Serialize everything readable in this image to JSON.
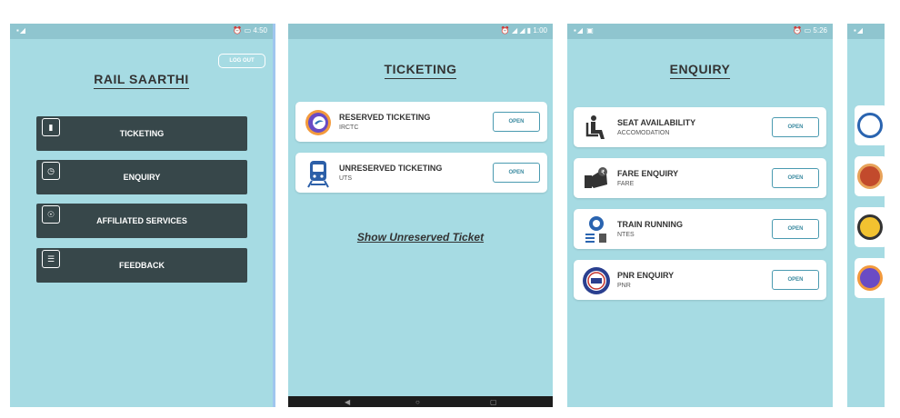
{
  "screen1": {
    "status_time": "4:50",
    "logout_label": "LOG OUT",
    "title": "RAIL SAARTHI",
    "menu": [
      {
        "label": "TICKETING",
        "icon": "ticket-icon"
      },
      {
        "label": "ENQUIRY",
        "icon": "clock-icon"
      },
      {
        "label": "AFFILIATED SERVICES",
        "icon": "services-icon"
      },
      {
        "label": "FEEDBACK",
        "icon": "feedback-icon"
      }
    ]
  },
  "screen2": {
    "status_time": "1:00",
    "title": "TICKETING",
    "cards": [
      {
        "title": "RESERVED TICKETING",
        "sub": "IRCTC",
        "button": "OPEN",
        "icon": "irctc-logo-icon"
      },
      {
        "title": "UNRESERVED TICKETING",
        "sub": "UTS",
        "button": "OPEN",
        "icon": "train-icon"
      }
    ],
    "link": "Show Unreserved Ticket"
  },
  "screen3": {
    "status_time": "5:26",
    "title": "ENQUIRY",
    "cards": [
      {
        "title": "SEAT AVAILABILITY",
        "sub": "ACCOMODATION",
        "button": "OPEN",
        "icon": "seat-icon"
      },
      {
        "title": "FARE ENQUIRY",
        "sub": "FARE",
        "button": "OPEN",
        "icon": "fare-icon"
      },
      {
        "title": "TRAIN RUNNING",
        "sub": "NTES",
        "button": "OPEN",
        "icon": "ntes-logo-icon"
      },
      {
        "title": "PNR ENQUIRY",
        "sub": "PNR",
        "button": "OPEN",
        "icon": "indian-railways-logo-icon"
      }
    ]
  },
  "colors": {
    "background": "#a6dbe3",
    "status_bar": "#8fc5cf",
    "menu_button": "#37474a",
    "card": "#ffffff",
    "open_button_border": "#4a9ab0"
  }
}
